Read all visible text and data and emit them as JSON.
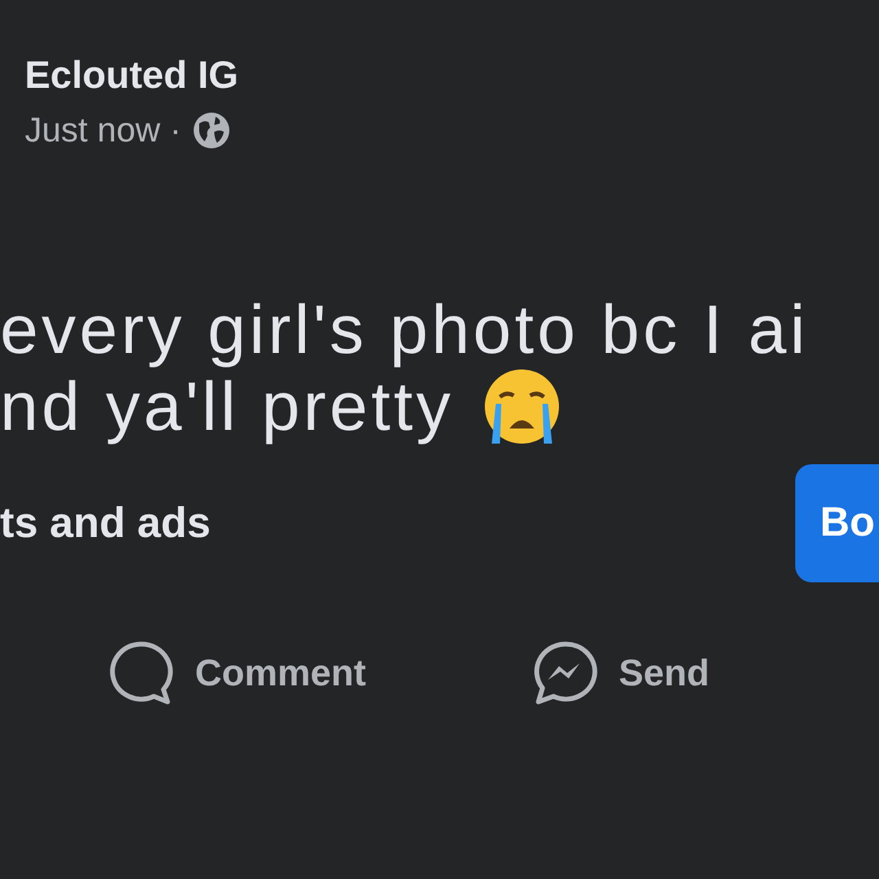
{
  "post": {
    "author": "Eclouted IG",
    "time": "Just now ·",
    "text_lines": [
      "every girl's photo bc I ai",
      "nd ya'll pretty"
    ]
  },
  "boost": {
    "text": "ts and ads",
    "button": "Bo"
  },
  "actions": [
    {
      "kind": "comment",
      "label": "Comment"
    },
    {
      "kind": "send",
      "label": "Send"
    }
  ]
}
